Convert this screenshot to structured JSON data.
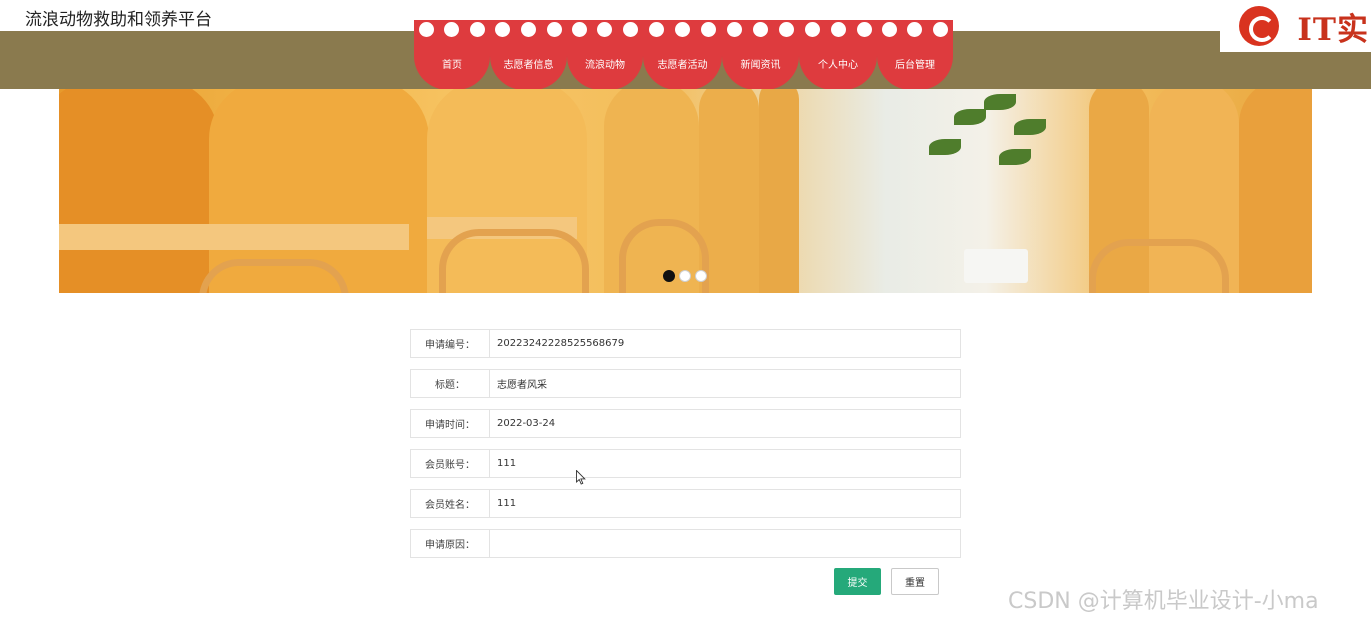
{
  "site": {
    "title": "流浪动物救助和领养平台"
  },
  "logo": {
    "text": "IT实",
    "icon": "chrome-icon"
  },
  "nav": {
    "items": [
      {
        "label": "首页",
        "name": "home"
      },
      {
        "label": "志愿者信息",
        "name": "volunteer-info"
      },
      {
        "label": "流浪动物",
        "name": "stray-animals"
      },
      {
        "label": "志愿者活动",
        "name": "volunteer-activities"
      },
      {
        "label": "新闻资讯",
        "name": "news"
      },
      {
        "label": "个人中心",
        "name": "personal-center"
      },
      {
        "label": "后台管理",
        "name": "admin"
      }
    ]
  },
  "carousel": {
    "slide_count": 3,
    "active_index": 0
  },
  "form": {
    "fields": [
      {
        "label": "申请编号：",
        "value": "20223242228525568679",
        "name": "application-number"
      },
      {
        "label": "标题：",
        "value": "志愿者风采",
        "name": "title"
      },
      {
        "label": "申请时间：",
        "value": "2022-03-24",
        "name": "application-time"
      },
      {
        "label": "会员账号：",
        "value": "111",
        "name": "member-account"
      },
      {
        "label": "会员姓名：",
        "value": "111",
        "name": "member-name"
      },
      {
        "label": "申请原因：",
        "value": "",
        "name": "application-reason"
      }
    ],
    "submit_label": "提交",
    "reset_label": "重置"
  },
  "watermark": {
    "text": "CSDN @计算机毕业设计-小ma"
  },
  "colors": {
    "navbar": "#8a7a4e",
    "menu": "#de3b3e",
    "submit": "#25a97a"
  }
}
